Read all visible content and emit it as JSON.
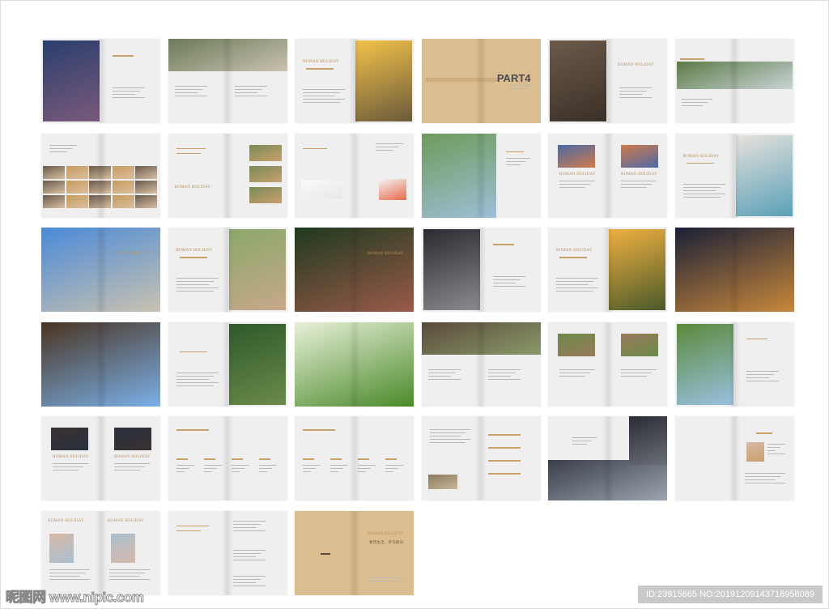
{
  "brand_title": "ROMAN HOLIDAY",
  "part_label": "PART4",
  "back_cover_slogan": "尊贵生活，罗马假日",
  "watermark": {
    "site": "昵图网 www.nipic.com",
    "id": "ID:23915665 NO:20191209143718958089"
  },
  "colors": {
    "gold": "#c8a06a",
    "tan": "#dbbd8f",
    "page": "#efefef"
  },
  "spreads": [
    {
      "kind": "photo-left",
      "colors": [
        "#2a3e6e",
        "#7a5a7a"
      ]
    },
    {
      "kind": "top-band",
      "colors": [
        "#6c7a58",
        "#c9c2b0"
      ]
    },
    {
      "kind": "photo-right",
      "colors": [
        "#f3c24a",
        "#6a5a3a"
      ],
      "title": true
    },
    {
      "kind": "part"
    },
    {
      "kind": "photo-left",
      "colors": [
        "#6d5a4a",
        "#3a3028"
      ],
      "title": true
    },
    {
      "kind": "band",
      "colors": [
        "#5d7a46",
        "#c9d4d6"
      ]
    },
    {
      "kind": "mosaic",
      "colors": [
        "#c89a5e",
        "#6a5a4e"
      ]
    },
    {
      "kind": "small-right",
      "colors": [
        "#7a8a5a",
        "#c8a06a"
      ],
      "title": true
    },
    {
      "kind": "chart"
    },
    {
      "kind": "photo-left-wide",
      "colors": [
        "#6f9a5a",
        "#9cc0d8"
      ]
    },
    {
      "kind": "two-small",
      "colors": [
        "#4a6aa8",
        "#d27a4a"
      ],
      "title": true
    },
    {
      "kind": "photo-right",
      "colors": [
        "#e6e2dc",
        "#5aa0b8"
      ],
      "title": true
    },
    {
      "kind": "full",
      "colors": [
        "#4a8ad8",
        "#c9c2b0"
      ],
      "title": true
    },
    {
      "kind": "photo-right",
      "colors": [
        "#8aa86a",
        "#c8a88a"
      ],
      "title": true
    },
    {
      "kind": "full",
      "colors": [
        "#1e3a1e",
        "#9a5a4a"
      ],
      "title": true
    },
    {
      "kind": "photo-left",
      "colors": [
        "#2a2a30",
        "#8a8a90"
      ]
    },
    {
      "kind": "photo-right",
      "colors": [
        "#f0b040",
        "#4a5a2a"
      ],
      "title": true
    },
    {
      "kind": "full",
      "colors": [
        "#1a2038",
        "#c8883a"
      ]
    },
    {
      "kind": "full",
      "colors": [
        "#4a3422",
        "#7ab0e8"
      ]
    },
    {
      "kind": "photo-right",
      "colors": [
        "#2e5a2a",
        "#6a8a4a"
      ]
    },
    {
      "kind": "full",
      "colors": [
        "#e8f0d8",
        "#4a8a2a"
      ]
    },
    {
      "kind": "top-band",
      "colors": [
        "#5a4a3a",
        "#8a9a6a"
      ]
    },
    {
      "kind": "two-small",
      "colors": [
        "#6a8a4a",
        "#9a7a5a"
      ]
    },
    {
      "kind": "photo-left",
      "colors": [
        "#5a8a3a",
        "#9ac0e0"
      ]
    },
    {
      "kind": "two-small",
      "colors": [
        "#3a3230",
        "#2a3040"
      ],
      "title": true
    },
    {
      "kind": "timeline"
    },
    {
      "kind": "timeline"
    },
    {
      "kind": "text-photo",
      "colors": [
        "#8a7a5a",
        "#c8b89a"
      ]
    },
    {
      "kind": "building",
      "colors": [
        "#3a3e48",
        "#9aa4b0"
      ]
    },
    {
      "kind": "plan",
      "colors": [
        "#d8b8a8",
        "#c8a06a"
      ]
    },
    {
      "kind": "plans",
      "colors": [
        "#d8b8a8",
        "#a8c0d0"
      ],
      "title": true
    },
    {
      "kind": "text"
    },
    {
      "kind": "back"
    }
  ]
}
